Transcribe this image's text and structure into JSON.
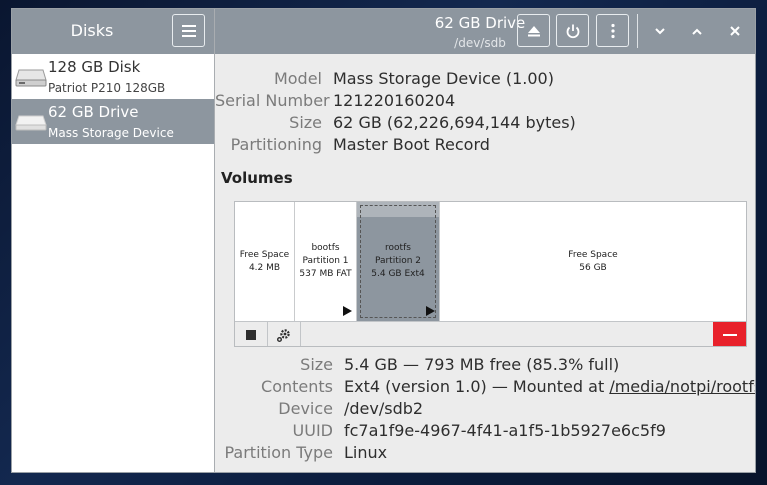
{
  "sidebar": {
    "title": "Disks",
    "menu_icon": "hamburger-menu-icon",
    "disks": [
      {
        "name": "128 GB Disk",
        "subtitle": "Patriot P210 128GB",
        "icon": "hard-disk-icon",
        "selected": false
      },
      {
        "name": "62 GB Drive",
        "subtitle": "Mass Storage Device",
        "icon": "drive-icon",
        "selected": true
      }
    ]
  },
  "header": {
    "title": "62 GB Drive",
    "subtitle": "/dev/sdb",
    "buttons": [
      "eject-icon",
      "power-icon",
      "more-options-icon"
    ],
    "window_controls": [
      "minimize-icon",
      "maximize-icon",
      "close-icon"
    ]
  },
  "drive_info": {
    "model_label": "Model",
    "model": "Mass Storage Device (1.00)",
    "serial_label": "Serial Number",
    "serial": "121220160204",
    "size_label": "Size",
    "size": "62 GB (62,226,694,144 bytes)",
    "partitioning_label": "Partitioning",
    "partitioning": "Master Boot Record"
  },
  "volumes": {
    "title": "Volumes",
    "partitions": [
      {
        "line1": "Free Space",
        "line2": "4.2 MB",
        "line3": ""
      },
      {
        "line1": "bootfs",
        "line2": "Partition 1",
        "line3": "537 MB FAT"
      },
      {
        "line1": "rootfs",
        "line2": "Partition 2",
        "line3": "5.4 GB Ext4"
      },
      {
        "line1": "Free Space",
        "line2": "56 GB",
        "line3": ""
      }
    ],
    "toolbar": [
      "stop-icon",
      "settings-gear-icon",
      "delete-minus-icon"
    ]
  },
  "partition_info": {
    "size_label": "Size",
    "size": "5.4 GB — 793 MB free (85.3% full)",
    "contents_label": "Contents",
    "contents_prefix": "Ext4 (version 1.0) — Mounted at ",
    "mount_point": "/media/notpi/rootfs",
    "device_label": "Device",
    "device": "/dev/sdb2",
    "uuid_label": "UUID",
    "uuid": "fc7a1f9e-4967-4f41-a1f5-1b5927e6c5f9",
    "type_label": "Partition Type",
    "type": "Linux"
  },
  "colors": {
    "header_bg": "#8d969f",
    "selected_bg": "#8d969f",
    "delete_red": "#e8212b"
  }
}
